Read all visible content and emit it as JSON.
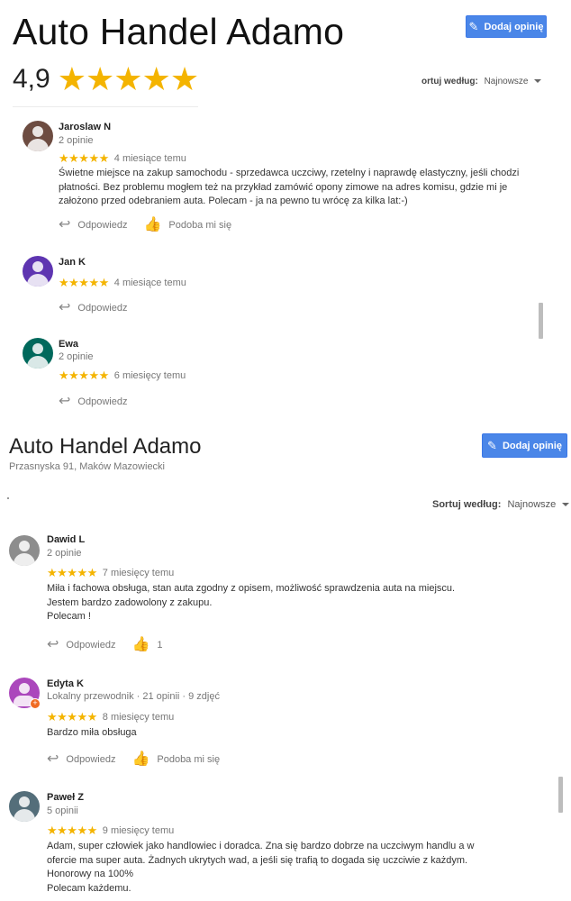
{
  "top": {
    "title": "Auto Handel Adamo",
    "rating": "4,9",
    "stars": "★★★★★",
    "add_review": "Dodaj opinię",
    "sort_label": "ortuj według:",
    "sort_value": "Najnowsze",
    "reviews": [
      {
        "avatar_color": "#6d4c41",
        "name": "Jaroslaw N",
        "sub": "2 opinie",
        "stars": "★★★★★",
        "time": "4 miesiące temu",
        "text": "Świetne miejsce na zakup samochodu - sprzedawca uczciwy, rzetelny i naprawdę elastyczny, jeśli chodzi płatności. Bez problemu mogłem też na przykład zamówić opony zimowe na adres komisu, gdzie mi je założono przed odebraniem auta. Polecam - ja na pewno tu wrócę za kilka lat:-)",
        "reply": "Odpowiedz",
        "like": "Podoba mi się"
      },
      {
        "avatar_color": "#5e35b1",
        "name": "Jan K",
        "stars": "★★★★★",
        "time": "4 miesiące temu",
        "reply": "Odpowiedz"
      },
      {
        "avatar_color": "#00695c",
        "name": "Ewa",
        "sub": "2 opinie",
        "stars": "★★★★★",
        "time": "6 miesięcy temu",
        "reply": "Odpowiedz"
      }
    ]
  },
  "bottom": {
    "title": "Auto Handel Adamo",
    "address": "Przasnyska 91, Maków Mazowiecki",
    "add_review": "Dodaj opinię",
    "sort_label": "Sortuj według:",
    "sort_value": "Najnowsze",
    "reviews": [
      {
        "avatar_color": "#8d8d8d",
        "name": "Dawid L",
        "sub": "2 opinie",
        "stars": "★★★★★",
        "time": "7 miesięcy temu",
        "text_lines": [
          "Miła i fachowa obsługa, stan auta zgodny z opisem, możliwość sprawdzenia auta na miejscu.",
          "Jestem bardzo zadowolony z zakupu.",
          "Polecam !"
        ],
        "reply": "Odpowiedz",
        "likes": "1"
      },
      {
        "avatar_color": "#ab47bc",
        "name": "Edyta K",
        "sub": "Lokalny przewodnik · 21 opinii · 9 zdjęć",
        "stars": "★★★★★",
        "time": "8 miesięcy temu",
        "text": "Bardzo miła obsługa",
        "reply": "Odpowiedz",
        "like": "Podoba mi się"
      },
      {
        "avatar_color": "#546e7a",
        "name": "Paweł Z",
        "sub": "5 opinii",
        "stars": "★★★★★",
        "time": "9 miesięcy temu",
        "text_lines": [
          "Adam, super człowiek jako handlowiec i doradca. Zna się bardzo dobrze na uczciwym handlu a w",
          "ofercie ma super auta. Żadnych ukrytych wad, a jeśli się trafią to dogada się uczciwie z każdym.",
          "Honorowy na 100%",
          "Polecam każdemu."
        ]
      }
    ]
  }
}
